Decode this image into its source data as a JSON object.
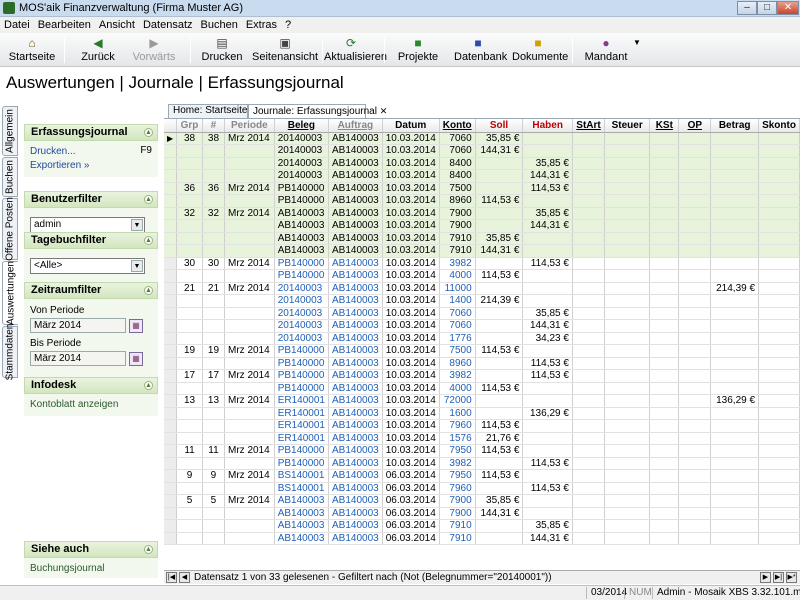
{
  "window": {
    "title": "MOS'aik Finanzverwaltung (Firma Muster AG)"
  },
  "menu": [
    "Datei",
    "Bearbeiten",
    "Ansicht",
    "Datensatz",
    "Buchen",
    "Extras",
    "?"
  ],
  "toolbar": {
    "items": [
      "Startseite",
      "Zurück",
      "Vorwärts",
      "Drucken",
      "Seitenansicht",
      "Aktualisieren",
      "Projekte",
      "Datenbank",
      "Dokumente",
      "Mandant"
    ]
  },
  "page": {
    "title": "Auswertungen | Journale | Erfassungsjournal"
  },
  "vtabs": [
    "Allgemein",
    "Buchen",
    "Offene Posten",
    "Auswertungen",
    "Stammdaten"
  ],
  "doctabs": [
    "Home: Startseite",
    "Journale: Erfassungsjournal"
  ],
  "panels": {
    "erfassungsjournal": {
      "title": "Erfassungsjournal",
      "print": "Drucken...",
      "print_key": "F9",
      "export": "Exportieren »"
    },
    "benutzerfilter": {
      "title": "Benutzerfilter",
      "value": "admin"
    },
    "tagebuchfilter": {
      "title": "Tagebuchfilter",
      "value": "<Alle>"
    },
    "zeitraumfilter": {
      "title": "Zeitraumfilter",
      "von_label": "Von Periode",
      "von": "März 2014",
      "bis_label": "Bis Periode",
      "bis": "März 2014"
    },
    "infodesk": {
      "title": "Infodesk",
      "link": "Kontoblatt anzeigen"
    },
    "siehe_auch": {
      "title": "Siehe auch",
      "link": "Buchungsjournal"
    }
  },
  "grid": {
    "columns": [
      "Grp",
      "#",
      "Periode",
      "Beleg",
      "Auftrag",
      "Datum",
      "Konto",
      "Soll",
      "Haben",
      "StArt",
      "Steuer",
      "KSt",
      "OP",
      "Betrag",
      "Skonto"
    ],
    "rows": [
      {
        "g": 1,
        "grp": "38",
        "n": "38",
        "per": "Mrz 2014",
        "beleg": "20140003",
        "auf": "AB140003",
        "dat": "10.03.2014",
        "konto": "7060",
        "soll": "35,85 €",
        "haben": "",
        "betrag": ""
      },
      {
        "g": 1,
        "grp": "",
        "n": "",
        "per": "",
        "beleg": "20140003",
        "auf": "AB140003",
        "dat": "10.03.2014",
        "konto": "7060",
        "soll": "144,31 €",
        "haben": "",
        "betrag": ""
      },
      {
        "g": 1,
        "grp": "",
        "n": "",
        "per": "",
        "beleg": "20140003",
        "auf": "AB140003",
        "dat": "10.03.2014",
        "konto": "8400",
        "soll": "",
        "haben": "35,85 €",
        "betrag": ""
      },
      {
        "g": 1,
        "grp": "",
        "n": "",
        "per": "",
        "beleg": "20140003",
        "auf": "AB140003",
        "dat": "10.03.2014",
        "konto": "8400",
        "soll": "",
        "haben": "144,31 €",
        "betrag": ""
      },
      {
        "g": 1,
        "grp": "36",
        "n": "36",
        "per": "Mrz 2014",
        "beleg": "PB140000",
        "auf": "AB140003",
        "dat": "10.03.2014",
        "konto": "7500",
        "soll": "",
        "haben": "114,53 €",
        "betrag": ""
      },
      {
        "g": 1,
        "grp": "",
        "n": "",
        "per": "",
        "beleg": "PB140000",
        "auf": "AB140003",
        "dat": "10.03.2014",
        "konto": "8960",
        "soll": "114,53 €",
        "haben": "",
        "betrag": ""
      },
      {
        "g": 1,
        "grp": "32",
        "n": "32",
        "per": "Mrz 2014",
        "beleg": "AB140003",
        "auf": "AB140003",
        "dat": "10.03.2014",
        "konto": "7900",
        "soll": "",
        "haben": "35,85 €",
        "betrag": ""
      },
      {
        "g": 1,
        "grp": "",
        "n": "",
        "per": "",
        "beleg": "AB140003",
        "auf": "AB140003",
        "dat": "10.03.2014",
        "konto": "7900",
        "soll": "",
        "haben": "144,31 €",
        "betrag": ""
      },
      {
        "g": 1,
        "grp": "",
        "n": "",
        "per": "",
        "beleg": "AB140003",
        "auf": "AB140003",
        "dat": "10.03.2014",
        "konto": "7910",
        "soll": "35,85 €",
        "haben": "",
        "betrag": ""
      },
      {
        "g": 1,
        "grp": "",
        "n": "",
        "per": "",
        "beleg": "AB140003",
        "auf": "AB140003",
        "dat": "10.03.2014",
        "konto": "7910",
        "soll": "144,31 €",
        "haben": "",
        "betrag": ""
      },
      {
        "g": 0,
        "grp": "30",
        "n": "30",
        "per": "Mrz 2014",
        "beleg": "PB140000",
        "auf": "AB140003",
        "dat": "10.03.2014",
        "konto": "3982",
        "soll": "",
        "haben": "114,53 €",
        "betrag": ""
      },
      {
        "g": 0,
        "grp": "",
        "n": "",
        "per": "",
        "beleg": "PB140000",
        "auf": "AB140003",
        "dat": "10.03.2014",
        "konto": "4000",
        "soll": "114,53 €",
        "haben": "",
        "betrag": ""
      },
      {
        "g": 0,
        "grp": "21",
        "n": "21",
        "per": "Mrz 2014",
        "beleg": "20140003",
        "auf": "AB140003",
        "dat": "10.03.2014",
        "konto": "11000",
        "soll": "",
        "haben": "",
        "betrag": "214,39 €"
      },
      {
        "g": 0,
        "grp": "",
        "n": "",
        "per": "",
        "beleg": "20140003",
        "auf": "AB140003",
        "dat": "10.03.2014",
        "konto": "1400",
        "soll": "214,39 €",
        "haben": "",
        "betrag": ""
      },
      {
        "g": 0,
        "grp": "",
        "n": "",
        "per": "",
        "beleg": "20140003",
        "auf": "AB140003",
        "dat": "10.03.2014",
        "konto": "7060",
        "soll": "",
        "haben": "35,85 €",
        "betrag": ""
      },
      {
        "g": 0,
        "grp": "",
        "n": "",
        "per": "",
        "beleg": "20140003",
        "auf": "AB140003",
        "dat": "10.03.2014",
        "konto": "7060",
        "soll": "",
        "haben": "144,31 €",
        "betrag": ""
      },
      {
        "g": 0,
        "grp": "",
        "n": "",
        "per": "",
        "beleg": "20140003",
        "auf": "AB140003",
        "dat": "10.03.2014",
        "konto": "1776",
        "soll": "",
        "haben": "34,23 €",
        "betrag": ""
      },
      {
        "g": 0,
        "grp": "19",
        "n": "19",
        "per": "Mrz 2014",
        "beleg": "PB140000",
        "auf": "AB140003",
        "dat": "10.03.2014",
        "konto": "7500",
        "soll": "114,53 €",
        "haben": "",
        "betrag": ""
      },
      {
        "g": 0,
        "grp": "",
        "n": "",
        "per": "",
        "beleg": "PB140000",
        "auf": "AB140003",
        "dat": "10.03.2014",
        "konto": "8960",
        "soll": "",
        "haben": "114,53 €",
        "betrag": ""
      },
      {
        "g": 0,
        "grp": "17",
        "n": "17",
        "per": "Mrz 2014",
        "beleg": "PB140000",
        "auf": "AB140003",
        "dat": "10.03.2014",
        "konto": "3982",
        "soll": "",
        "haben": "114,53 €",
        "betrag": ""
      },
      {
        "g": 0,
        "grp": "",
        "n": "",
        "per": "",
        "beleg": "PB140000",
        "auf": "AB140003",
        "dat": "10.03.2014",
        "konto": "4000",
        "soll": "114,53 €",
        "haben": "",
        "betrag": ""
      },
      {
        "g": 0,
        "grp": "13",
        "n": "13",
        "per": "Mrz 2014",
        "beleg": "ER140001",
        "auf": "AB140003",
        "dat": "10.03.2014",
        "konto": "72000",
        "soll": "",
        "haben": "",
        "betrag": "136,29 €"
      },
      {
        "g": 0,
        "grp": "",
        "n": "",
        "per": "",
        "beleg": "ER140001",
        "auf": "AB140003",
        "dat": "10.03.2014",
        "konto": "1600",
        "soll": "",
        "haben": "136,29 €",
        "betrag": ""
      },
      {
        "g": 0,
        "grp": "",
        "n": "",
        "per": "",
        "beleg": "ER140001",
        "auf": "AB140003",
        "dat": "10.03.2014",
        "konto": "7960",
        "soll": "114,53 €",
        "haben": "",
        "betrag": ""
      },
      {
        "g": 0,
        "grp": "",
        "n": "",
        "per": "",
        "beleg": "ER140001",
        "auf": "AB140003",
        "dat": "10.03.2014",
        "konto": "1576",
        "soll": "21,76 €",
        "haben": "",
        "betrag": ""
      },
      {
        "g": 0,
        "grp": "11",
        "n": "11",
        "per": "Mrz 2014",
        "beleg": "PB140000",
        "auf": "AB140003",
        "dat": "10.03.2014",
        "konto": "7950",
        "soll": "114,53 €",
        "haben": "",
        "betrag": ""
      },
      {
        "g": 0,
        "grp": "",
        "n": "",
        "per": "",
        "beleg": "PB140000",
        "auf": "AB140003",
        "dat": "10.03.2014",
        "konto": "3982",
        "soll": "",
        "haben": "114,53 €",
        "betrag": ""
      },
      {
        "g": 0,
        "grp": "9",
        "n": "9",
        "per": "Mrz 2014",
        "beleg": "BS140001",
        "auf": "AB140003",
        "dat": "06.03.2014",
        "konto": "7950",
        "soll": "114,53 €",
        "haben": "",
        "betrag": ""
      },
      {
        "g": 0,
        "grp": "",
        "n": "",
        "per": "",
        "beleg": "BS140001",
        "auf": "AB140003",
        "dat": "06.03.2014",
        "konto": "7960",
        "soll": "",
        "haben": "114,53 €",
        "betrag": ""
      },
      {
        "g": 0,
        "grp": "5",
        "n": "5",
        "per": "Mrz 2014",
        "beleg": "AB140003",
        "auf": "AB140003",
        "dat": "06.03.2014",
        "konto": "7900",
        "soll": "35,85 €",
        "haben": "",
        "betrag": ""
      },
      {
        "g": 0,
        "grp": "",
        "n": "",
        "per": "",
        "beleg": "AB140003",
        "auf": "AB140003",
        "dat": "06.03.2014",
        "konto": "7900",
        "soll": "144,31 €",
        "haben": "",
        "betrag": ""
      },
      {
        "g": 0,
        "grp": "",
        "n": "",
        "per": "",
        "beleg": "AB140003",
        "auf": "AB140003",
        "dat": "06.03.2014",
        "konto": "7910",
        "soll": "",
        "haben": "35,85 €",
        "betrag": ""
      },
      {
        "g": 0,
        "grp": "",
        "n": "",
        "per": "",
        "beleg": "AB140003",
        "auf": "AB140003",
        "dat": "06.03.2014",
        "konto": "7910",
        "soll": "",
        "haben": "144,31 €",
        "betrag": ""
      }
    ]
  },
  "nav": {
    "status": "Datensatz 1 von 33 gelesenen - Gefiltert nach (Not (Belegnummer=\"20140001\"))"
  },
  "statusbar": {
    "period": "03/2014",
    "num": "NUM",
    "db": "Admin - Mosaik XBS 3.32.101.mdb"
  },
  "colors": {
    "green_row": "#e8f3dc",
    "blue_text": "#2060b8",
    "soll": "#c00000",
    "haben": "#c00000"
  }
}
